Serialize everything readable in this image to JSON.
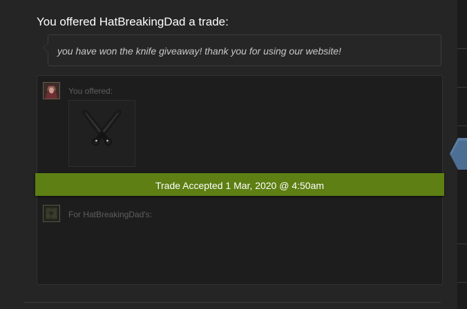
{
  "offer": {
    "title": "You offered HatBreakingDad a trade:",
    "message": "you have won the knife giveaway! thank you for using our website!"
  },
  "your_side": {
    "label": "You offered:",
    "item_icon": "shadow-daggers-knife"
  },
  "status": {
    "text": "Trade Accepted 1 Mar, 2020 @ 4:50am"
  },
  "their_side": {
    "label": "For HatBreakingDad's:"
  },
  "colors": {
    "background": "#252525",
    "panel": "#1d1d1d",
    "accepted_banner": "#5d7f13",
    "nav_arrow": "#4d6f94"
  }
}
